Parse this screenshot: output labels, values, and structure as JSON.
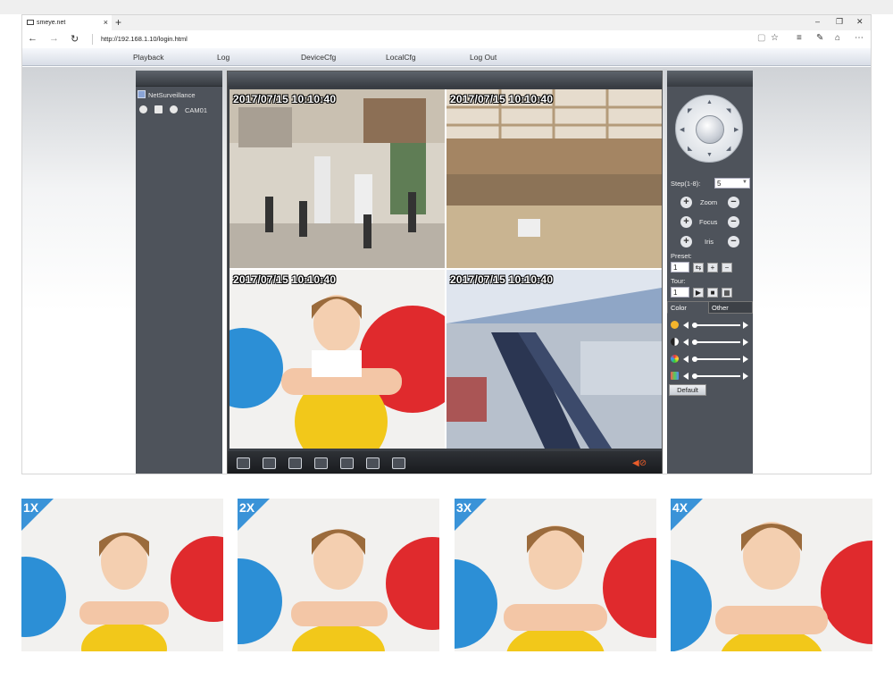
{
  "browser": {
    "tab_title": "smeye.net",
    "tab_close": "×",
    "new_tab": "+",
    "url": "http://192.168.1.10/login.html",
    "window_controls": {
      "minimize": "–",
      "restore": "❐",
      "close": "✕"
    }
  },
  "menu": [
    "Playback",
    "Log",
    "DeviceCfg",
    "LocalCfg",
    "Log Out"
  ],
  "left_panel": {
    "tree_root": "NetSurveillance",
    "camera": "CAM01"
  },
  "video": {
    "timestamps": [
      "2017/07/15  10:10:40",
      "2017/07/15  10:10:40",
      "2017/07/15  10:10:40",
      "2017/07/15  10:10:40"
    ]
  },
  "ptz": {
    "step_label": "Step(1-8):",
    "step_value": "5",
    "zoom_label": "Zoom",
    "focus_label": "Focus",
    "iris_label": "Iris",
    "preset_label": "Preset:",
    "preset_value": "1",
    "tour_label": "Tour:",
    "tour_value": "1",
    "tab_color": "Color",
    "tab_other": "Other",
    "default_button": "Default"
  },
  "zoom_levels": [
    "1X",
    "2X",
    "3X",
    "4X"
  ],
  "colors": {
    "accent": "#3a93d8",
    "panel": "#4e535b",
    "volume": "#e85c2a"
  }
}
